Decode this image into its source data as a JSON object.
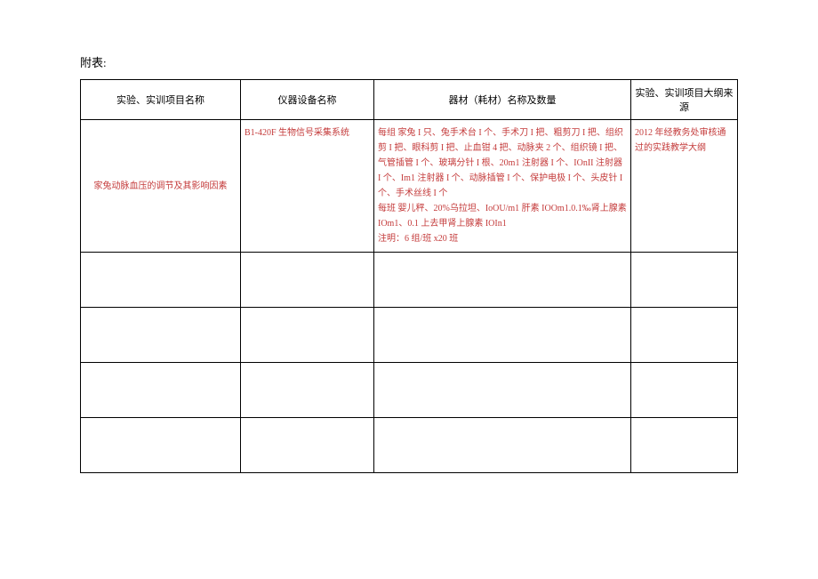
{
  "title": "附表:",
  "headers": {
    "col1": "实验、实训项目名称",
    "col2": "仪器设备名称",
    "col3": "器材（耗材）名称及数量",
    "col4": "实验、实训项目大纲来源"
  },
  "rows": [
    {
      "project_name": "家兔动脉血压的调节及其影响因素",
      "equipment": "B1-420F 生物信号采集系统",
      "materials": "每组  家兔 I 只、兔手术台 I 个、手术刀 I 把、粗剪刀 I 把、组织剪 I 把、眼科剪 I 把、止血钳 4 把、动脉夹 2 个、组织镜 I 把、气管插管 I 个、玻璃分针 I 根、20m1 注射器 I 个、IOnII 注射器 I 个、Im1 注射器 I 个、动脉插管 I 个、保护电极 I 个、头皮针 I 个、手术丝线 I 个\n每班  婴儿秤、20%乌拉坦、IoOU/m1 肝素 IOOm1.0.1‰肾上腺素 IOm1、0.1 上去甲肾上腺素 IOIn1\n注明：6 组/班 x20 班",
      "source": "2012 年经教务处审核通过的实践教学大纲"
    }
  ]
}
